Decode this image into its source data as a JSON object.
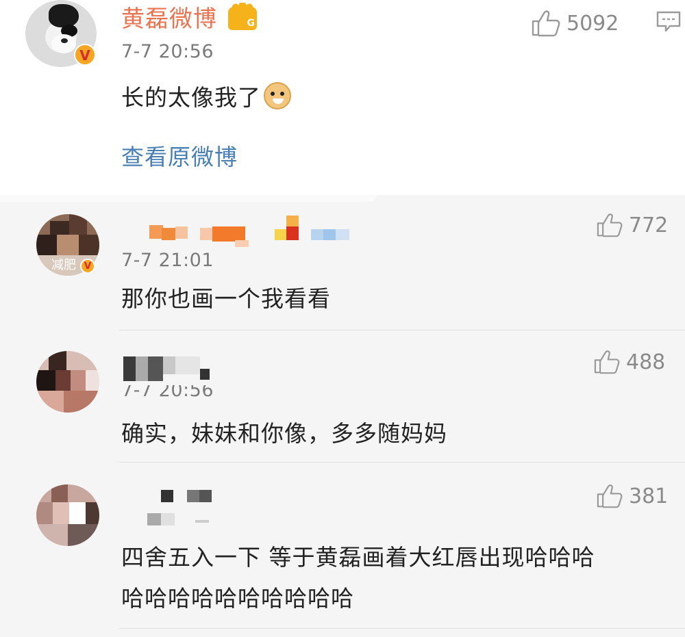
{
  "post": {
    "username": "黄磊微博",
    "member_badge_letter": "G",
    "verified_mark": "V",
    "time": "7-7 20:56",
    "text": "长的太像我了",
    "emoji": "doge-emoji",
    "view_original_label": "查看原微博",
    "like_count": "5092"
  },
  "comments": [
    {
      "avatar_label": "减肥",
      "verified_mark": "V",
      "time": "7-7 21:01",
      "text": "那你也画一个我看看",
      "like_count": "772"
    },
    {
      "time": "7-7 20:56",
      "text": "确实，妹妹和你像，多多随妈妈",
      "like_count": "488"
    },
    {
      "text_line1": "四舍五入一下 等于黄磊画着大红唇出现哈哈哈",
      "text_line2": "哈哈哈哈哈哈哈哈哈哈",
      "like_count": "381"
    }
  ],
  "colors": {
    "username": "#eb7350",
    "link": "#4a7fb5",
    "badge_gold": "#f6b21b",
    "comment_bg": "#f5f5f5"
  }
}
